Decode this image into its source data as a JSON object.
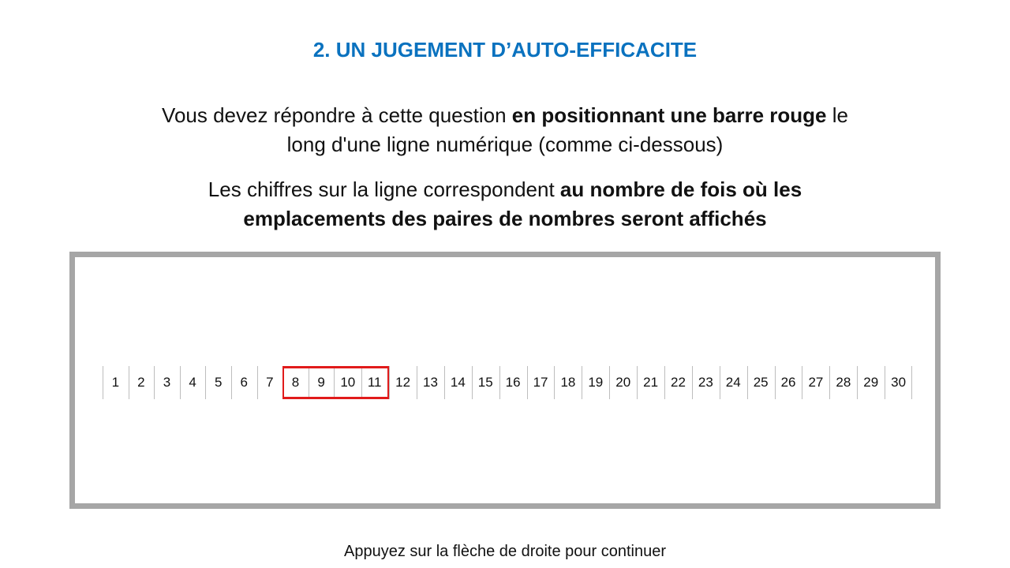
{
  "title": "2. UN JUGEMENT D’AUTO-EFFICACITE",
  "instruction1": {
    "part1": "Vous devez répondre à cette question ",
    "bold": "en positionnant une barre rouge",
    "part2": " le long d'une ligne numérique (comme ci-dessous)"
  },
  "instruction2": {
    "part1": "Les chiffres sur la ligne correspondent ",
    "bold": "au nombre de fois où les emplacements des paires de nombres seront affichés"
  },
  "scale": {
    "numbers": [
      "1",
      "2",
      "3",
      "4",
      "5",
      "6",
      "7",
      "8",
      "9",
      "10",
      "11",
      "12",
      "13",
      "14",
      "15",
      "16",
      "17",
      "18",
      "19",
      "20",
      "21",
      "22",
      "23",
      "24",
      "25",
      "26",
      "27",
      "28",
      "29",
      "30"
    ],
    "selection_range": [
      8,
      11
    ],
    "selection_color": "#e11b1b"
  },
  "footer": "Appuyez sur la flèche de droite pour continuer",
  "colors": {
    "title": "#0a72bf",
    "frame_border": "#a6a6a6"
  }
}
